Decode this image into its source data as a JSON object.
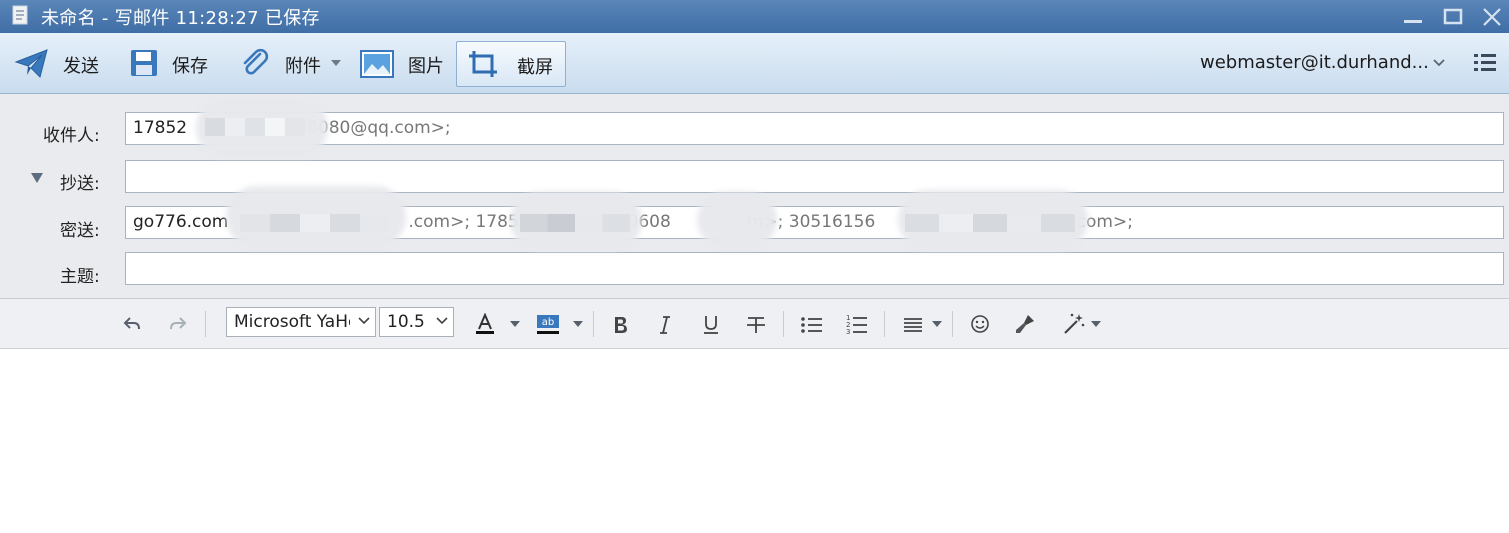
{
  "window": {
    "title": "未命名 - 写邮件   11:28:27 已保存"
  },
  "toolbar": {
    "send_label": "发送",
    "save_label": "保存",
    "attach_label": "附件",
    "image_label": "图片",
    "screenshot_label": "截屏",
    "account": "webmaster@it.durhand..."
  },
  "fields": {
    "to_label": "收件人:",
    "to_start": "17852",
    "to_end": "6080@qq.com>;",
    "cc_label": "抄送:",
    "cc_value": "",
    "bcc_label": "密送:",
    "bcc_seg1": "go776.com",
    "bcc_seg2": ".com>; 1785",
    "bcc_seg3": "20608",
    "bcc_seg4": "m>; 30516156",
    "bcc_seg5": ".com>;",
    "subject_label": "主题:",
    "subject_value": ""
  },
  "format": {
    "font_name": "Microsoft YaHei",
    "font_size": "10.5"
  },
  "colors": {
    "title_bar": "#4a7ab0",
    "toolbar_top": "#e6f0fa",
    "toolbar_bottom": "#c9dcee",
    "icon_blue": "#2f6db3"
  }
}
